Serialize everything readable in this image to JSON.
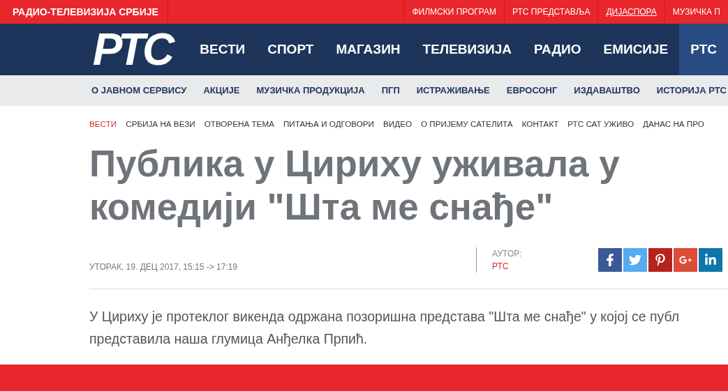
{
  "top_bar": {
    "site_name": "РАДИО-ТЕЛЕВИЗИЈА СРБИЈЕ",
    "links": [
      {
        "label": "ФИЛМСКИ ПРОГРАМ",
        "selected": false
      },
      {
        "label": "РТС ПРЕДСТАВЉА",
        "selected": false
      },
      {
        "label": "ДИЈАСПОРА",
        "selected": true
      },
      {
        "label": "МУЗИЧКА П",
        "selected": false
      }
    ]
  },
  "header": {
    "logo": "РТС",
    "nav": [
      {
        "label": "ВЕСТИ",
        "selected": false
      },
      {
        "label": "СПОРТ",
        "selected": false
      },
      {
        "label": "МАГАЗИН",
        "selected": false
      },
      {
        "label": "ТЕЛЕВИЗИЈА",
        "selected": false
      },
      {
        "label": "РАДИО",
        "selected": false
      },
      {
        "label": "ЕМИСИЈЕ",
        "selected": false
      },
      {
        "label": "РТС",
        "selected": true
      }
    ]
  },
  "sub_nav": [
    "О ЈАВНОМ СЕРВИСУ",
    "АКЦИЈЕ",
    "МУЗИЧКА ПРОДУКЦИЈА",
    "ПГП",
    "ИСТРАЖИВАЊЕ",
    "ЕВРОСОНГ",
    "ИЗДАВАШТВО",
    "ИСТОРИЈА РТС"
  ],
  "section_nav": [
    {
      "label": "ВЕСТИ",
      "selected": true
    },
    {
      "label": "СРБИЈА НА ВЕЗИ",
      "selected": false
    },
    {
      "label": "ОТВОРЕНА ТЕМА",
      "selected": false
    },
    {
      "label": "ПИТАЊА И ОДГОВОРИ",
      "selected": false
    },
    {
      "label": "ВИДЕО",
      "selected": false
    },
    {
      "label": "О ПРИЈЕМУ САТЕЛИТА",
      "selected": false
    },
    {
      "label": "КОНТАКТ",
      "selected": false
    },
    {
      "label": "РТС САТ УЖИВО",
      "selected": false
    },
    {
      "label": "ДАНАС НА ПРО",
      "selected": false
    }
  ],
  "article": {
    "headline": "Публика у Цириху уживала у комедији \"Шта ме снађе\"",
    "date": "УТОРАК, 19. ДЕЦ 2017, 15:15 -> 17:19",
    "author_label": "АУТОР:",
    "author": "РТС",
    "share": [
      {
        "kind": "facebook",
        "color": "#3b5998"
      },
      {
        "kind": "twitter",
        "color": "#55acee"
      },
      {
        "kind": "pinterest",
        "color": "#b5221f"
      },
      {
        "kind": "googleplus",
        "color": "#dd4b39"
      },
      {
        "kind": "linkedin",
        "color": "#0e76a8"
      }
    ],
    "lead": [
      "У Цириху је протеклог викенда одржана позоришна представа \"Шта ме снађе\" у којој се публ",
      "представила наша глумица Анђелка Прпић."
    ]
  }
}
